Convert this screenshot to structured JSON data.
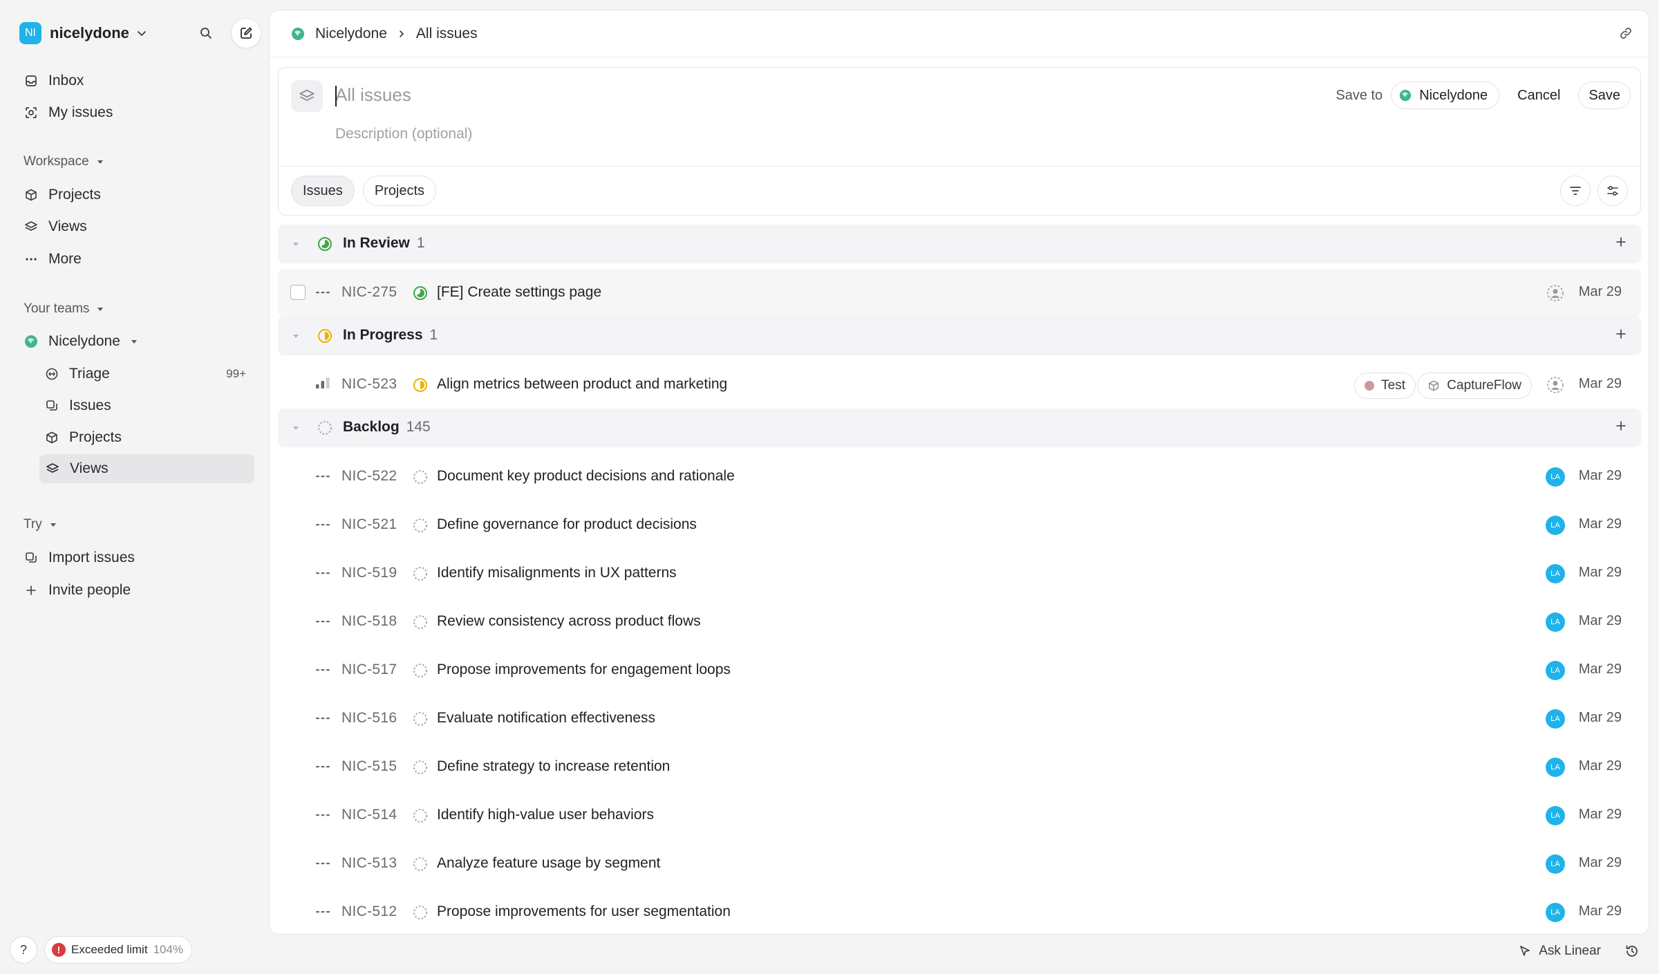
{
  "workspace": {
    "initials": "NI",
    "name": "nicelydone"
  },
  "nav": {
    "inbox": "Inbox",
    "my_issues": "My issues",
    "workspace_label": "Workspace",
    "projects": "Projects",
    "views": "Views",
    "more": "More",
    "teams_label": "Your teams",
    "team_name": "Nicelydone",
    "triage": "Triage",
    "triage_count": "99+",
    "issues": "Issues",
    "team_projects": "Projects",
    "team_views": "Views",
    "try_label": "Try",
    "import_issues": "Import issues",
    "invite_people": "Invite people"
  },
  "footer": {
    "help": "?",
    "limit_label": "Exceeded limit",
    "limit_pct": "104%",
    "ask": "Ask Linear"
  },
  "header": {
    "team": "Nicelydone",
    "page": "All issues"
  },
  "composer": {
    "title_placeholder": "All issues",
    "desc_placeholder": "Description (optional)",
    "save_to_label": "Save to",
    "save_to_team": "Nicelydone",
    "cancel": "Cancel",
    "save": "Save"
  },
  "tabs": [
    {
      "label": "Issues",
      "active": true
    },
    {
      "label": "Projects",
      "active": false
    }
  ],
  "colors": {
    "in_review": "#3fa845",
    "in_progress": "#e8b400",
    "backlog": "#a9aab0",
    "avatar": "#1fb3ea",
    "error": "#d63d3d"
  },
  "groups": [
    {
      "name": "In Review",
      "count": "1",
      "status": "in_review",
      "issues": [
        {
          "id": "NIC-275",
          "title": "[FE] Create settings page",
          "date": "Mar 29",
          "assignee": "unassigned",
          "priority": "none",
          "labels": []
        }
      ]
    },
    {
      "name": "In Progress",
      "count": "1",
      "status": "in_progress",
      "issues": [
        {
          "id": "NIC-523",
          "title": "Align metrics between product and marketing",
          "date": "Mar 29",
          "assignee": "unassigned",
          "priority": "medium",
          "labels": [
            "Test",
            "CaptureFlow"
          ]
        }
      ]
    },
    {
      "name": "Backlog",
      "count": "145",
      "status": "backlog",
      "issues": [
        {
          "id": "NIC-522",
          "title": "Document key product decisions and rationale",
          "date": "Mar 29",
          "assignee": "LA"
        },
        {
          "id": "NIC-521",
          "title": "Define governance for product decisions",
          "date": "Mar 29",
          "assignee": "LA"
        },
        {
          "id": "NIC-519",
          "title": "Identify misalignments in UX patterns",
          "date": "Mar 29",
          "assignee": "LA"
        },
        {
          "id": "NIC-518",
          "title": "Review consistency across product flows",
          "date": "Mar 29",
          "assignee": "LA"
        },
        {
          "id": "NIC-517",
          "title": "Propose improvements for engagement loops",
          "date": "Mar 29",
          "assignee": "LA"
        },
        {
          "id": "NIC-516",
          "title": "Evaluate notification effectiveness",
          "date": "Mar 29",
          "assignee": "LA"
        },
        {
          "id": "NIC-515",
          "title": "Define strategy to increase retention",
          "date": "Mar 29",
          "assignee": "LA"
        },
        {
          "id": "NIC-514",
          "title": "Identify high-value user behaviors",
          "date": "Mar 29",
          "assignee": "LA"
        },
        {
          "id": "NIC-513",
          "title": "Analyze feature usage by segment",
          "date": "Mar 29",
          "assignee": "LA"
        },
        {
          "id": "NIC-512",
          "title": "Propose improvements for user segmentation",
          "date": "Mar 29",
          "assignee": "LA"
        }
      ]
    }
  ]
}
